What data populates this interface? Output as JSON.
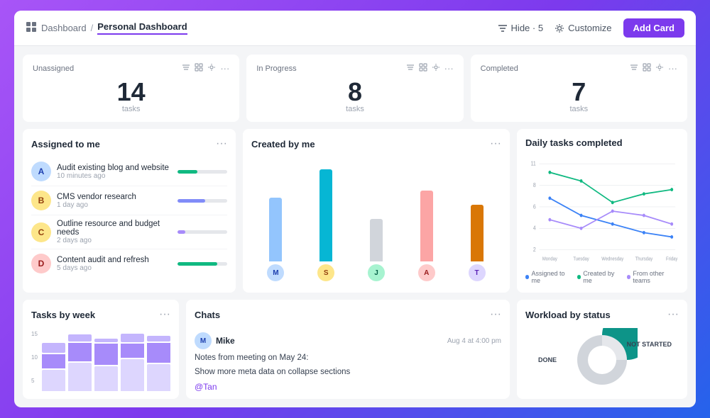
{
  "header": {
    "breadcrumb_root": "Dashboard",
    "breadcrumb_active": "Personal Dashboard",
    "hide_label": "Hide · 5",
    "customize_label": "Customize",
    "add_card_label": "Add Card"
  },
  "stat_cards": [
    {
      "title": "Unassigned",
      "number": "14",
      "unit": "tasks"
    },
    {
      "title": "In Progress",
      "number": "8",
      "unit": "tasks"
    },
    {
      "title": "Completed",
      "number": "7",
      "unit": "tasks"
    }
  ],
  "assigned_to_me": {
    "title": "Assigned to me",
    "tasks": [
      {
        "name": "Audit existing blog and website",
        "time": "10 minutes ago",
        "progress": 40,
        "color": "#10b981",
        "avatar_color": "#93c5fd",
        "avatar_text": "A"
      },
      {
        "name": "CMS vendor research",
        "time": "1 day ago",
        "progress": 55,
        "color": "#818cf8",
        "avatar_color": "#fbbf24",
        "avatar_text": "B"
      },
      {
        "name": "Outline resource and budget needs",
        "time": "2 days ago",
        "progress": 15,
        "color": "#a78bfa",
        "avatar_color": "#fbbf24",
        "avatar_text": "C"
      },
      {
        "name": "Content audit and refresh",
        "time": "5 days ago",
        "progress": 80,
        "color": "#10b981",
        "avatar_color": "#f87171",
        "avatar_text": "D"
      }
    ]
  },
  "created_by_me": {
    "title": "Created by me",
    "bars": [
      {
        "height1": 90,
        "color1": "#93c5fd",
        "avatar_color": "#60a5fa",
        "avatar_text": "M"
      },
      {
        "height1": 130,
        "color1": "#06b6d4",
        "avatar_color": "#f59e0b",
        "avatar_text": "S"
      },
      {
        "height1": 60,
        "color1": "#d1d5db",
        "avatar_color": "#34d399",
        "avatar_text": "J"
      },
      {
        "height1": 100,
        "color1": "#fca5a5",
        "avatar_color": "#f87171",
        "avatar_text": "A"
      },
      {
        "height1": 80,
        "color1": "#d97706",
        "avatar_color": "#a78bfa",
        "avatar_text": "T"
      }
    ]
  },
  "daily_tasks": {
    "title": "Daily tasks completed",
    "legend": [
      {
        "label": "Assigned to me",
        "color": "#3b82f6"
      },
      {
        "label": "Created by me",
        "color": "#10b981"
      },
      {
        "label": "From other teams",
        "color": "#a78bfa"
      }
    ],
    "x_labels": [
      "Monday",
      "Tuesday",
      "Wednesday",
      "Thursday",
      "Friday"
    ]
  },
  "tasks_by_week": {
    "title": "Tasks by week",
    "y_labels": [
      "15",
      "10",
      "5"
    ],
    "bars": [
      {
        "seg1": 30,
        "seg2": 20,
        "seg3": 15
      },
      {
        "seg1": 40,
        "seg2": 25,
        "seg3": 10
      },
      {
        "seg1": 35,
        "seg2": 30,
        "seg3": 5
      },
      {
        "seg1": 45,
        "seg2": 20,
        "seg3": 12
      },
      {
        "seg1": 38,
        "seg2": 28,
        "seg3": 8
      }
    ]
  },
  "chats": {
    "title": "Chats",
    "user": "Mike",
    "timestamp": "Aug 4 at 4:00 pm",
    "message_line1": "Notes from meeting on May 24:",
    "message_line2": "Show more meta data on collapse sections",
    "mention": "@Tan",
    "avatar_color": "#60a5fa",
    "avatar_text": "M"
  },
  "workload": {
    "title": "Workload by status",
    "labels": {
      "done": "DONE",
      "not_started": "NOT STARTED"
    }
  }
}
